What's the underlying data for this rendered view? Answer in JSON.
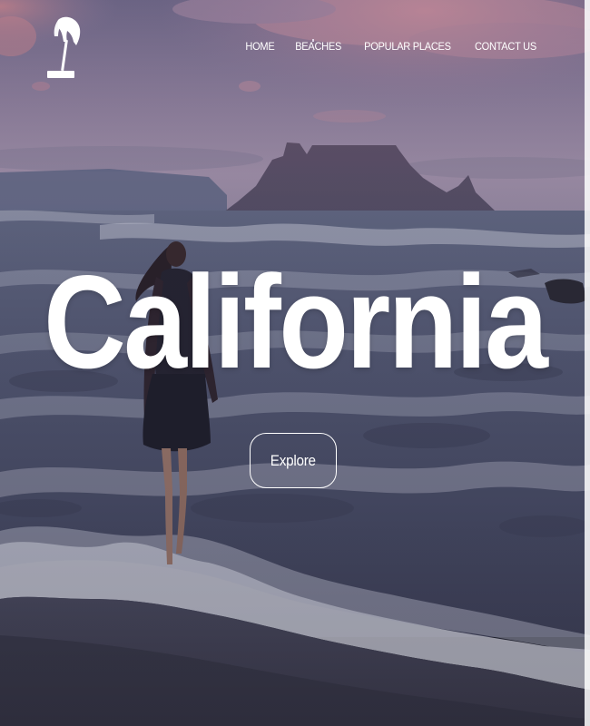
{
  "brand": {
    "logo_icon": "beach-umbrella-icon"
  },
  "nav": {
    "items": [
      {
        "label": "HOME"
      },
      {
        "label": "BEACHES"
      },
      {
        "label": "POPULAR PLACES"
      },
      {
        "label": "CONTACT US"
      }
    ]
  },
  "hero": {
    "title": "California",
    "cta_label": "Explore"
  },
  "colors": {
    "sky_top": "#6e6585",
    "sky_glow": "#b47c93",
    "sea": "#5a5f78",
    "foam": "#c9cad8",
    "text": "#ffffff"
  }
}
